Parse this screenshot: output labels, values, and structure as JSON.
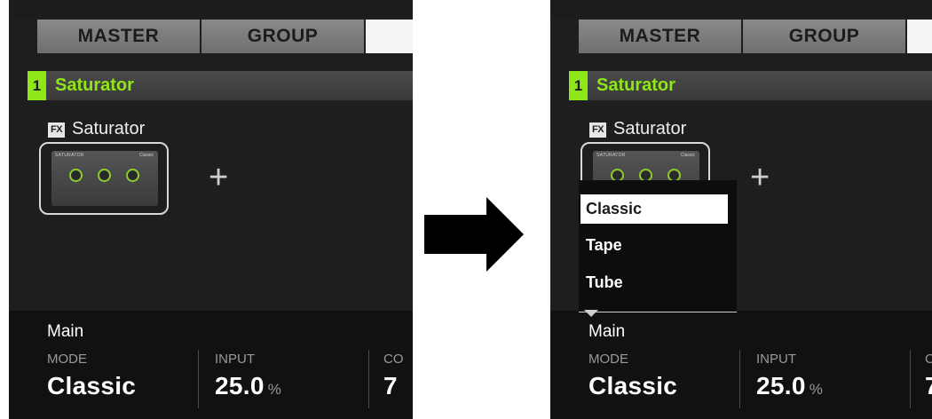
{
  "tabs": [
    "MASTER",
    "GROUP",
    ""
  ],
  "slot": {
    "number": "1",
    "name": "Saturator"
  },
  "plugin": {
    "fx_badge": "FX",
    "name": "Saturator",
    "thumb_header": "SATURATOR",
    "thumb_mode": "Classic",
    "add_icon": "+"
  },
  "bottom": {
    "section": "Main",
    "params": [
      {
        "label": "MODE",
        "value": "Classic",
        "unit": ""
      },
      {
        "label": "INPUT",
        "value": "25.0",
        "unit": "%"
      },
      {
        "label": "CO",
        "value": "7",
        "unit": ""
      }
    ]
  },
  "menu": {
    "items": [
      "Classic",
      "Tape",
      "Tube"
    ],
    "selected": "Classic"
  },
  "colors": {
    "accent": "#8fe619",
    "background": "#1e1e1e"
  },
  "icons": {
    "transition": "arrow-right-icon",
    "add": "plus-icon",
    "fx": "fx-icon"
  }
}
